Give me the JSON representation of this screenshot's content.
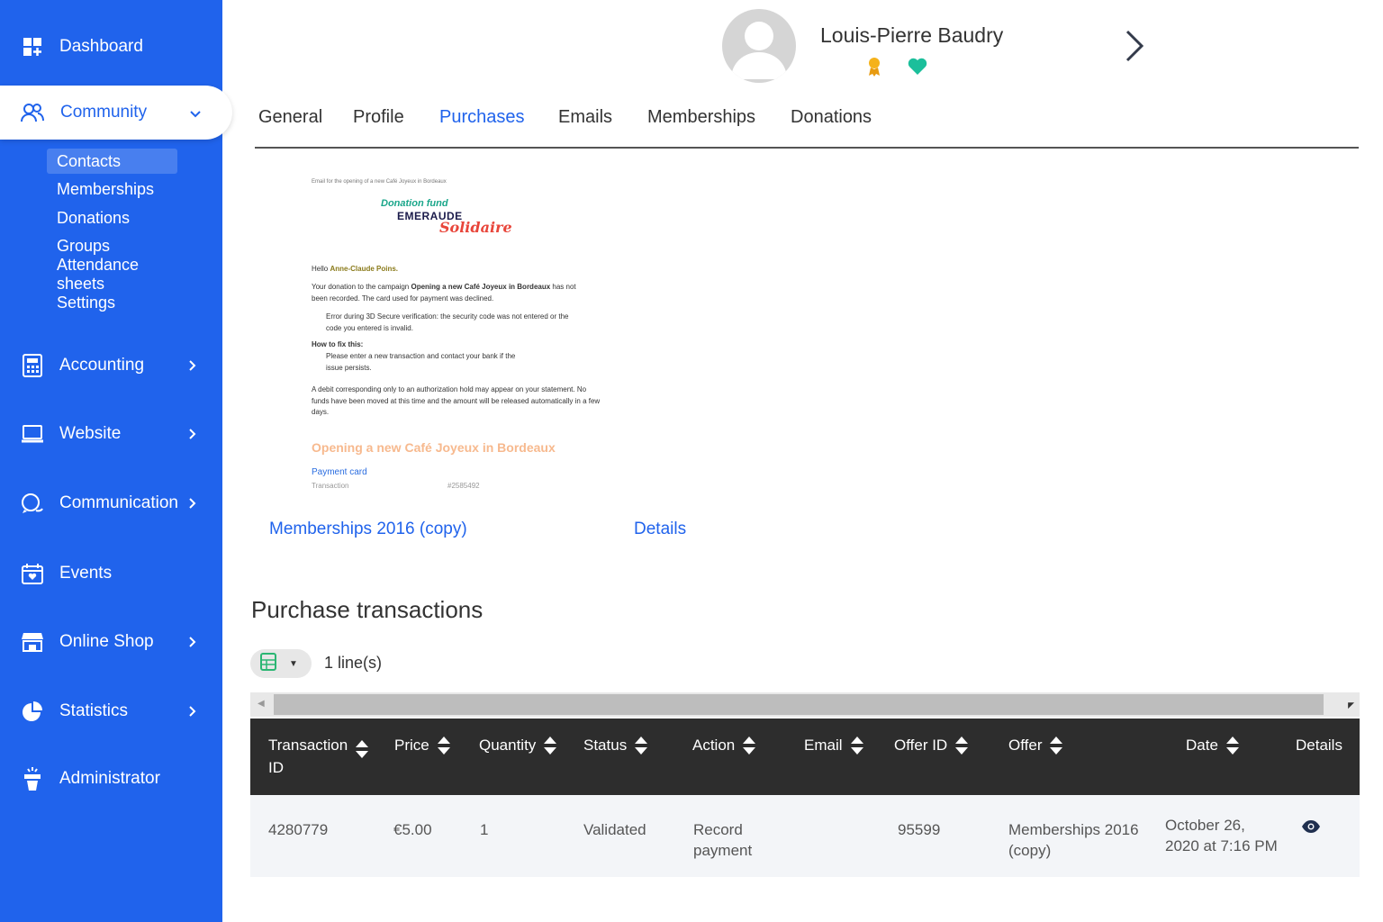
{
  "sidebar": {
    "dashboard": "Dashboard",
    "community": "Community",
    "community_sub": [
      "Contacts",
      "Memberships",
      "Donations",
      "Groups",
      "Attendance sheets",
      "Settings"
    ],
    "accounting": "Accounting",
    "website": "Website",
    "communication": "Communication",
    "events": "Events",
    "online_shop": "Online Shop",
    "statistics": "Statistics",
    "administrator": "Administrator"
  },
  "header": {
    "user_name": "Louis-Pierre Baudry"
  },
  "tabs": [
    "General",
    "Profile",
    "Purchases",
    "Emails",
    "Memberships",
    "Donations"
  ],
  "email_preview": {
    "subject": "Email for the opening of a new Café Joyeux in Bordeaux",
    "logo_line1": "Donation fund",
    "logo_line2": "EMERAUDE",
    "logo_line3": "Solidaire",
    "greeting": "Hello",
    "recipient": "Anne-Claude Poins.",
    "para1_a": "Your donation to the campaign",
    "para1_campaign": "Opening a new Café Joyeux in Bordeaux",
    "para1_b": "has not been recorded. The card used for payment was declined.",
    "error_text": "Error during 3D Secure verification: the security code was not entered or the code you entered is invalid.",
    "fix_title": "How to fix this:",
    "fix_text": "Please enter a new transaction and contact your bank if the issue persists.",
    "debit_text": "A debit corresponding only to an authorization hold may appear on your statement. No funds have been moved at this time and the amount will be released automatically in a few days.",
    "campaign_title": "Opening a new Café Joyeux in Bordeaux",
    "payment_method": "Payment card",
    "transaction_label": "Transaction",
    "transaction_ref": "#2585492"
  },
  "purchase": {
    "offer_link": "Memberships 2016 (copy)",
    "details_link": "Details"
  },
  "transactions": {
    "title": "Purchase transactions",
    "line_count": "1 line(s)",
    "columns": [
      "Transaction ID",
      "Price",
      "Quantity",
      "Status",
      "Action",
      "Email",
      "Offer ID",
      "Offer",
      "Date",
      "Details"
    ],
    "row": {
      "transaction_id": "4280779",
      "price": "€5.00",
      "quantity": "1",
      "status": "Validated",
      "action": "Record payment",
      "email": "",
      "offer_id": "95599",
      "offer": "Memberships 2016 (copy)",
      "date": "October 26, 2020 at 7:16 PM"
    }
  },
  "colors": {
    "sidebar": "#2063ec",
    "table_header": "#2d2d2d",
    "accent": "#2063ec",
    "heart": "#1bbf9b",
    "medal": "#f5b21b"
  }
}
